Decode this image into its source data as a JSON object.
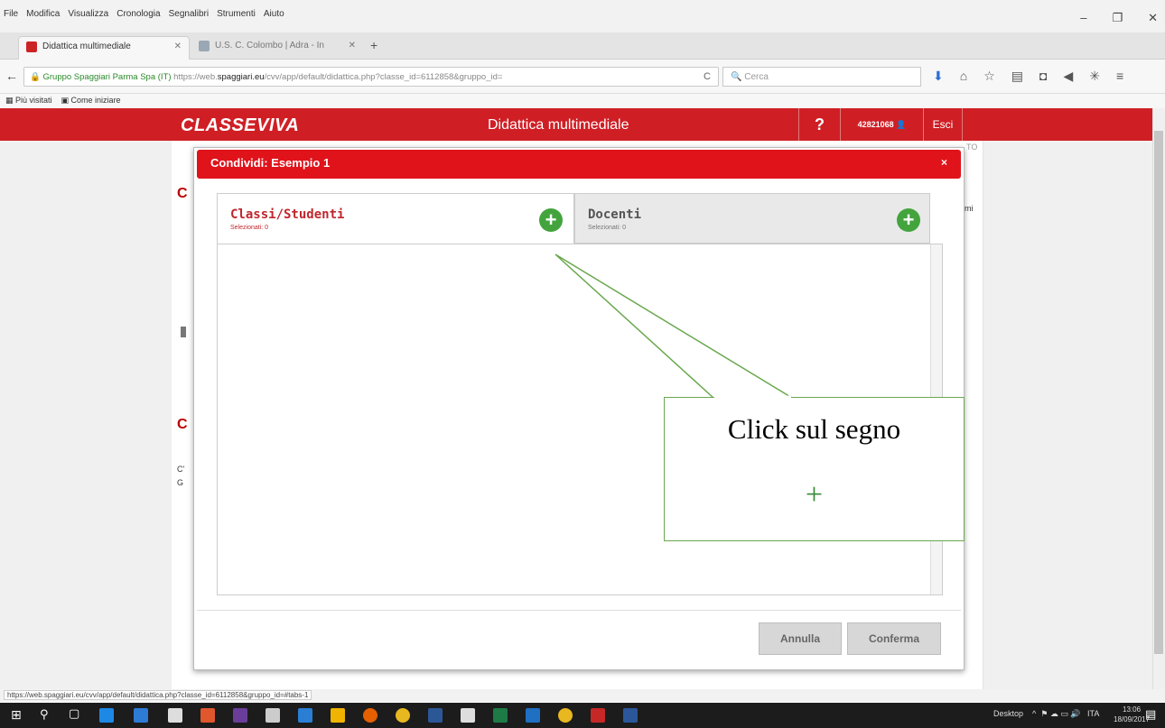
{
  "menu": [
    "File",
    "Modifica",
    "Visualizza",
    "Cronologia",
    "Segnalibri",
    "Strumenti",
    "Aiuto"
  ],
  "window_controls": [
    "–",
    "❐",
    "✕"
  ],
  "tabs": [
    {
      "label": "Didattica multimediale",
      "close": "✕"
    },
    {
      "label": "U.S. C. Colombo | Adra - In",
      "close": "✕"
    }
  ],
  "new_tab": "+",
  "nav": {
    "url_prefix": "Gruppo Spaggiari Parma Spa (IT)",
    "url_plain": "https://web.",
    "url_domain": "spaggiari.eu",
    "url_rest": "/cvv/app/default/didattica.php?classe_id=6112858&gruppo_id=",
    "search_placeholder": "Cerca",
    "reload": "C"
  },
  "bookmarks": [
    "Più visitati",
    "Come iniziare"
  ],
  "header": {
    "logo": "CLASSEVIVA",
    "title": "Didattica multimediale",
    "help": "?",
    "user_code": "42821068",
    "logout": "Esci"
  },
  "background_bits": {
    "right_top": "TO",
    "right_mid": "mi",
    "left_a": "C",
    "left_b": "C",
    "left_c": "C'",
    "left_d": "G"
  },
  "modal": {
    "title": "Condividi: Esempio 1",
    "close": "×",
    "tab_classi": {
      "title": "Classi/Studenti",
      "sub": "Selezionati: 0"
    },
    "tab_docenti": {
      "title": "Docenti",
      "sub": "Selezionati: 0"
    },
    "cancel": "Annulla",
    "confirm": "Conferma"
  },
  "callout": {
    "text": "Click sul segno",
    "symbol": "+"
  },
  "status_url": "https://web.spaggiari.eu/cvv/app/default/didattica.php?classe_id=6112858&gruppo_id=#tabs-1",
  "taskbar": {
    "desktop": "Desktop",
    "lang": "ITA",
    "time": "13:06",
    "date": "18/09/2017"
  },
  "colors": {
    "brand_red": "#cf1f25",
    "modal_red": "#e0131b",
    "plus_green": "#43a43d",
    "callout_green": "#6aa84f"
  }
}
